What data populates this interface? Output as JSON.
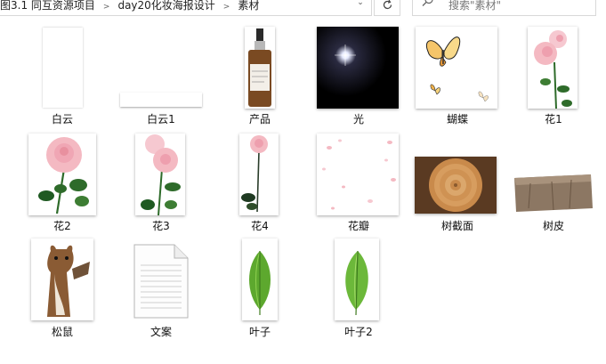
{
  "address_bar": {
    "crumbs": [
      "图3.1 同互资源项目 ",
      "day20化妆海报设计",
      "素材"
    ]
  },
  "search": {
    "placeholder": "搜索\"素材\""
  },
  "files": [
    {
      "name": "白云"
    },
    {
      "name": "白云1"
    },
    {
      "name": "产品"
    },
    {
      "name": "光"
    },
    {
      "name": "蝴蝶"
    },
    {
      "name": "花1"
    },
    {
      "name": "花2"
    },
    {
      "name": "花3"
    },
    {
      "name": "花4"
    },
    {
      "name": "花瓣"
    },
    {
      "name": "树截面"
    },
    {
      "name": "树皮"
    },
    {
      "name": "松鼠"
    },
    {
      "name": "文案"
    },
    {
      "name": "叶子"
    },
    {
      "name": "叶子2"
    }
  ],
  "colors": {
    "rose_pink": "#f4b9c2",
    "leaf_green": "#2e6b2a",
    "wood": "#c98a4b",
    "bark": "#8c7763"
  }
}
